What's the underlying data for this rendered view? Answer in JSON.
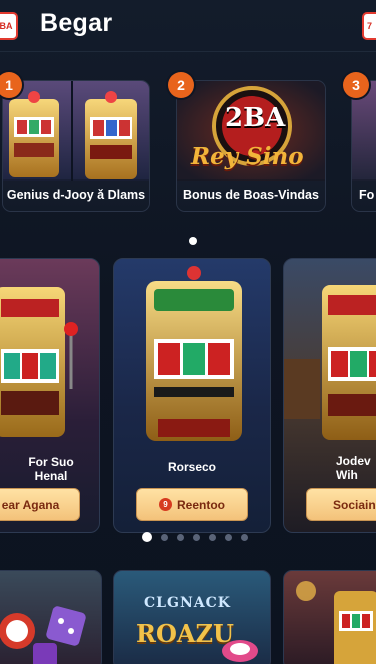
{
  "header": {
    "title": "Begar",
    "logo_left_text": "BA",
    "logo_right_text": "7"
  },
  "promos": [
    {
      "number": "1",
      "caption": "Genius d-Jooy ǎ Dlams"
    },
    {
      "number": "2",
      "caption": "Bonus de Boas-Vindas",
      "logo_top": "2BA",
      "logo_script": "Rey Sino"
    },
    {
      "number": "3",
      "caption": "Fo"
    }
  ],
  "games": [
    {
      "name_line1": "For Suo",
      "name_line2": "Henal",
      "button": "ear Agana"
    },
    {
      "name_line1": "Rorseco",
      "name_line2": "",
      "button": "Reentoo",
      "button_icon": "9"
    },
    {
      "name_line1": "Jodev",
      "name_line2": "Wih",
      "button": "Sociaino"
    }
  ],
  "bottom_cards": [
    {
      "label": ""
    },
    {
      "label_top": "CLGNACK",
      "label_bottom": "ROAZU"
    },
    {
      "label": ""
    }
  ],
  "colors": {
    "accent": "#e8641c",
    "button": "#f3c27a",
    "background": "#0f1624"
  },
  "pager": {
    "count": 8,
    "active": 0
  }
}
